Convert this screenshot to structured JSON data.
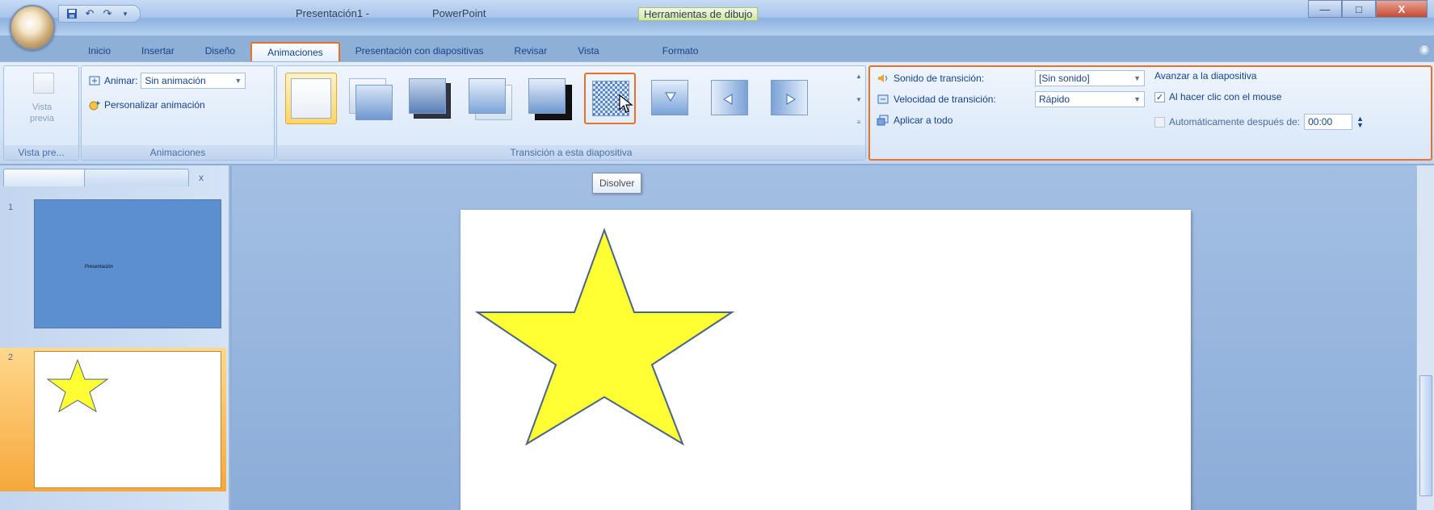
{
  "titlebar": {
    "doc_title": "Presentación1 -",
    "app_name": "PowerPoint",
    "context_tools": "Herramientas de dibujo",
    "window_buttons": [
      "—",
      "□",
      "X"
    ]
  },
  "qat": {
    "icons": [
      "save-icon",
      "undo-icon",
      "redo-icon",
      "customize-icon"
    ]
  },
  "tabs": [
    {
      "label": "Inicio",
      "active": false
    },
    {
      "label": "Insertar",
      "active": false
    },
    {
      "label": "Diseño",
      "active": false
    },
    {
      "label": "Animaciones",
      "active": true
    },
    {
      "label": "Presentación con diapositivas",
      "active": false
    },
    {
      "label": "Revisar",
      "active": false
    },
    {
      "label": "Vista",
      "active": false
    },
    {
      "label": "Formato",
      "active": false
    }
  ],
  "ribbon": {
    "preview": {
      "label_line1": "Vista",
      "label_line2": "previa",
      "group_label": "Vista pre..."
    },
    "animations": {
      "animate_label": "Animar:",
      "animate_value": "Sin animación",
      "custom_label": "Personalizar animación",
      "group_label": "Animaciones"
    },
    "transitions": {
      "group_label": "Transición a esta diapositiva",
      "gallery": [
        "Sin transición",
        "Desvanecer",
        "Desvanecer a negro",
        "Cortar",
        "Cortar a negro",
        "Disolver",
        "Barrido hacia abajo",
        "Barrido hacia la izquierda",
        "Barrido hacia la derecha"
      ],
      "selected_index": 0,
      "hover_index": 5
    },
    "options": {
      "sound_label": "Sonido de transición:",
      "sound_value": "[Sin sonido]",
      "speed_label": "Velocidad de transición:",
      "speed_value": "Rápido",
      "apply_all_label": "Aplicar a todo",
      "advance_label": "Avanzar a la diapositiva",
      "on_click_label": "Al hacer clic con el mouse",
      "on_click_checked": true,
      "auto_label": "Automáticamente después de:",
      "auto_checked": false,
      "auto_time": "00:00"
    }
  },
  "tooltip": "Disolver",
  "slides_pane": {
    "close_label": "x",
    "slides": [
      {
        "number": "1",
        "title_text": "Presentación"
      },
      {
        "number": "2"
      }
    ]
  },
  "colors": {
    "accent_highlight": "#e8702a",
    "star_fill": "#ffff33",
    "star_stroke": "#4a6488",
    "slide1_bg": "#5b8fd0"
  }
}
